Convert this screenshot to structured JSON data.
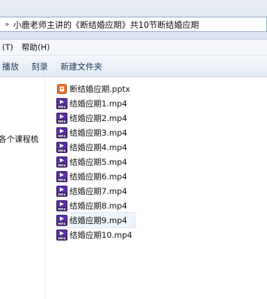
{
  "address_bar": {
    "chevron": "»",
    "path": "小鹿老师主讲的《断结婚应期》共10节断结婚应期"
  },
  "menu": {
    "items": [
      "(T)",
      "帮助(H)"
    ]
  },
  "toolbar": {
    "commands": [
      "播放",
      "刻录",
      "新建文件夹"
    ]
  },
  "nav_pane": {
    "visible_item": "各个课程梳"
  },
  "files": [
    {
      "name": "断结婚应期.pptx",
      "icon": "pptx-icon"
    },
    {
      "name": "结婚应期1.mp4",
      "icon": "mp4-icon"
    },
    {
      "name": "结婚应期2.mp4",
      "icon": "mp4-icon"
    },
    {
      "name": "结婚应期3.mp4",
      "icon": "mp4-icon"
    },
    {
      "name": "结婚应期4.mp4",
      "icon": "mp4-icon"
    },
    {
      "name": "结婚应期5.mp4",
      "icon": "mp4-icon"
    },
    {
      "name": "结婚应期6.mp4",
      "icon": "mp4-icon"
    },
    {
      "name": "结婚应期7.mp4",
      "icon": "mp4-icon"
    },
    {
      "name": "结婚应期8.mp4",
      "icon": "mp4-icon"
    },
    {
      "name": "结婚应期9.mp4",
      "icon": "mp4-icon",
      "hovered": true
    },
    {
      "name": "结婚应期10.mp4",
      "icon": "mp4-icon"
    }
  ],
  "colors": {
    "mp4_icon": "#5a2fa0",
    "pptx_icon": "#e8762b"
  }
}
